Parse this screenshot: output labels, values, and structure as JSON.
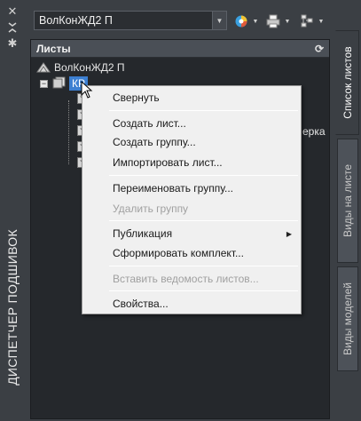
{
  "palette": {
    "sheet_set": "ВолКонЖД2 П"
  },
  "strip": {
    "title": "ДИСПЕТЧЕР ПОДШИВОК",
    "close_icon": "close-icon",
    "pin_icon": "pin-icon",
    "settings_icon": "gear-icon"
  },
  "toolbar": {
    "publish_icon": "publish-icon",
    "plot_icon": "plotter-icon",
    "model_views_icon": "model-views-icon"
  },
  "panel": {
    "header": "Листы",
    "refresh_icon": "refresh-icon",
    "root_label": "ВолКонЖД2 П",
    "group_label": "КР",
    "hidden_tail": "ерка"
  },
  "context_menu": {
    "items": [
      {
        "label": "Свернуть",
        "enabled": true
      },
      {
        "label": "Создать лист...",
        "enabled": true
      },
      {
        "label": "Создать группу...",
        "enabled": true
      },
      {
        "label": "Импортировать лист...",
        "enabled": true
      },
      {
        "label": "Переименовать группу...",
        "enabled": true
      },
      {
        "label": "Удалить группу",
        "enabled": false
      },
      {
        "label": "Публикация",
        "enabled": true
      },
      {
        "label": "Сформировать комплект...",
        "enabled": true
      },
      {
        "label": "Вставить ведомость листов...",
        "enabled": false
      },
      {
        "label": "Свойства...",
        "enabled": true
      }
    ]
  },
  "tabs": [
    {
      "label": "Список листов",
      "active": true
    },
    {
      "label": "Виды на листе",
      "active": false
    },
    {
      "label": "Виды моделей",
      "active": false
    }
  ],
  "colors": {
    "selection": "#3c7fd1",
    "panel_bg": "#25282c",
    "menu_bg": "#f0f0f0"
  }
}
